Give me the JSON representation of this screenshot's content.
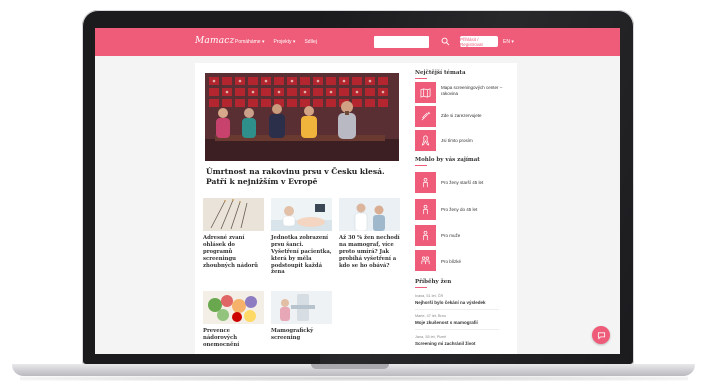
{
  "brand": {
    "logo": "Mamacz",
    "accent": "#ee5c79"
  },
  "nav": {
    "items": [
      "Pomáháme ▾",
      "Projekty ▾",
      "Sdílej"
    ],
    "search_placeholder": "",
    "login_label": "Přihlásit / Registrovat",
    "lang": "EN ▾"
  },
  "hero": {
    "title": "Úmrtnost na rakovinu prsu v Česku klesá. Patří k nejnižším v Evropě"
  },
  "cards": [
    {
      "title": "Adresné zvaní ohlásek do programů screeningu zhoubných nádorů",
      "image": "acupuncture-needles"
    },
    {
      "title": "Jednotka zobrazení prsu šanci. Vyšetření pacientka, která by měla podstoupit každá žena",
      "image": "ultrasound-exam"
    },
    {
      "title": "Až 30 % žen nechodí na mamograf, více proto umírá? Jak probíhá vyšetření a kdo se ho obává?",
      "image": "doctor-consultation"
    },
    {
      "title": "Prevence nádorových onemocnění",
      "image": "vegetables"
    },
    {
      "title": "Mamografický screening",
      "image": "mammography-machine"
    }
  ],
  "sidebar": {
    "section1_title": "Nejčtější témata",
    "section1_items": [
      {
        "label": "Mapa screeningových center – rakovina",
        "icon": "map-icon"
      },
      {
        "label": "Zde si zarezervujete",
        "icon": "syringe-icon"
      },
      {
        "label": "Jsi tímto prosím",
        "icon": "ribbon-icon"
      }
    ],
    "section2_title": "Mohlo by vás zajímat",
    "section2_items": [
      {
        "label": "Pro ženy starší 45 let",
        "icon": "person-icon"
      },
      {
        "label": "Pro ženy do 45 let",
        "icon": "person-icon"
      },
      {
        "label": "Pro muže",
        "icon": "person-icon"
      },
      {
        "label": "Pro blízké",
        "icon": "people-icon"
      }
    ],
    "section3_title": "Příběhy žen",
    "stories": [
      {
        "meta": "Ivana, 51 let, ČR",
        "title": "Nejhorší bylo čekání na výsledek"
      },
      {
        "meta": "Marie, 47 let, Brno",
        "title": "Moje zkušenost s mamografií"
      },
      {
        "meta": "Jana, 55 let, Plzeň",
        "title": "Screening mi zachránil život"
      }
    ]
  }
}
